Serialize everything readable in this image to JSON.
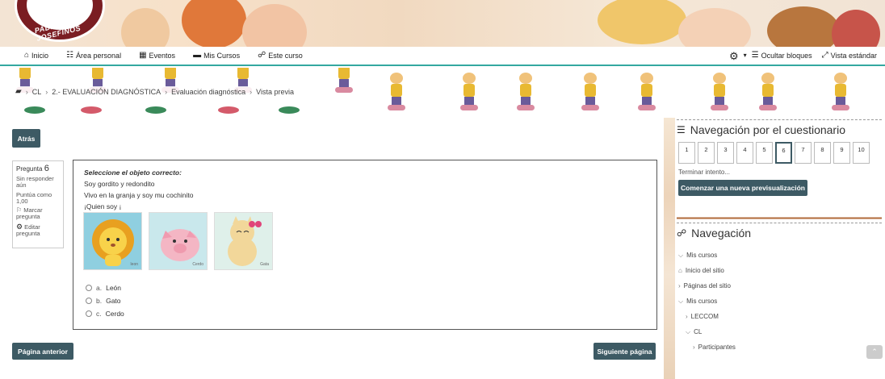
{
  "logo": {
    "text": "PADRES JOSEFINOS"
  },
  "nav": {
    "items": [
      {
        "icon": "home-icon",
        "glyph": "⌂",
        "label": "Inicio"
      },
      {
        "icon": "dashboard-icon",
        "glyph": "☷",
        "label": "Área personal"
      },
      {
        "icon": "calendar-icon",
        "glyph": "▦",
        "label": "Eventos"
      },
      {
        "icon": "graduation-cap-icon",
        "glyph": "▬",
        "label": "Mis Cursos"
      },
      {
        "icon": "sitemap-icon",
        "glyph": "☍",
        "label": "Este curso"
      }
    ],
    "settings_glyph": "⚙",
    "dropdown_glyph": "▾",
    "hide_blocks": {
      "glyph": "☰",
      "label": "Ocultar bloques"
    },
    "standard_view": {
      "glyph": "⤢",
      "label": "Vista estándar"
    }
  },
  "breadcrumb": {
    "folder_glyph": "▰",
    "items": [
      "CL",
      "2.- EVALUACIÓN DIAGNÓSTICA",
      "Evaluación diagnóstica",
      "Vista previa"
    ]
  },
  "back_button": "Atrás",
  "question_info": {
    "label": "Pregunta",
    "number": "6",
    "status": "Sin responder aún",
    "score": "Puntúa como 1,00",
    "flag_glyph": "⚐",
    "flag": "Marcar pregunta",
    "edit_glyph": "⚙",
    "edit": "Editar pregunta"
  },
  "question": {
    "prompt": "Seleccione el objeto correcto:",
    "lines": [
      "Soy gordito y redondito",
      "Vivo en la granja y soy mu cochinito",
      "¡Quien soy ¡"
    ],
    "images": [
      {
        "name": "lion",
        "caption": "leon"
      },
      {
        "name": "pig",
        "caption": "Cerdo"
      },
      {
        "name": "cat",
        "caption": "Gata"
      }
    ],
    "answers": [
      {
        "letter": "a.",
        "text": "León"
      },
      {
        "letter": "b.",
        "text": "Gato"
      },
      {
        "letter": "c.",
        "text": "Cerdo"
      }
    ]
  },
  "prev_button": "Página anterior",
  "next_button": "Siguiente página",
  "quiz_nav": {
    "title_glyph": "☰",
    "title": "Navegación por el cuestionario",
    "questions": [
      "1",
      "2",
      "3",
      "4",
      "5",
      "6",
      "7",
      "8",
      "9",
      "10"
    ],
    "current": "6",
    "finish": "Terminar intento...",
    "restart": "Comenzar una nueva previsualización"
  },
  "navigation": {
    "title_glyph": "☍",
    "title": "Navegación",
    "items": [
      {
        "glyph": "⌵",
        "label": "Mis cursos",
        "indent": 0
      },
      {
        "glyph": "⌂",
        "label": "Inicio del sitio",
        "indent": 0
      },
      {
        "glyph": "›",
        "label": "Páginas del sitio",
        "indent": 0
      },
      {
        "glyph": "⌵",
        "label": "Mis cursos",
        "indent": 0
      },
      {
        "glyph": "›",
        "label": "LECCOM",
        "indent": 1
      },
      {
        "glyph": "⌵",
        "label": "CL",
        "indent": 1
      },
      {
        "glyph": "›",
        "label": "Participantes",
        "indent": 2
      }
    ]
  },
  "scroll_top_glyph": "⌃"
}
